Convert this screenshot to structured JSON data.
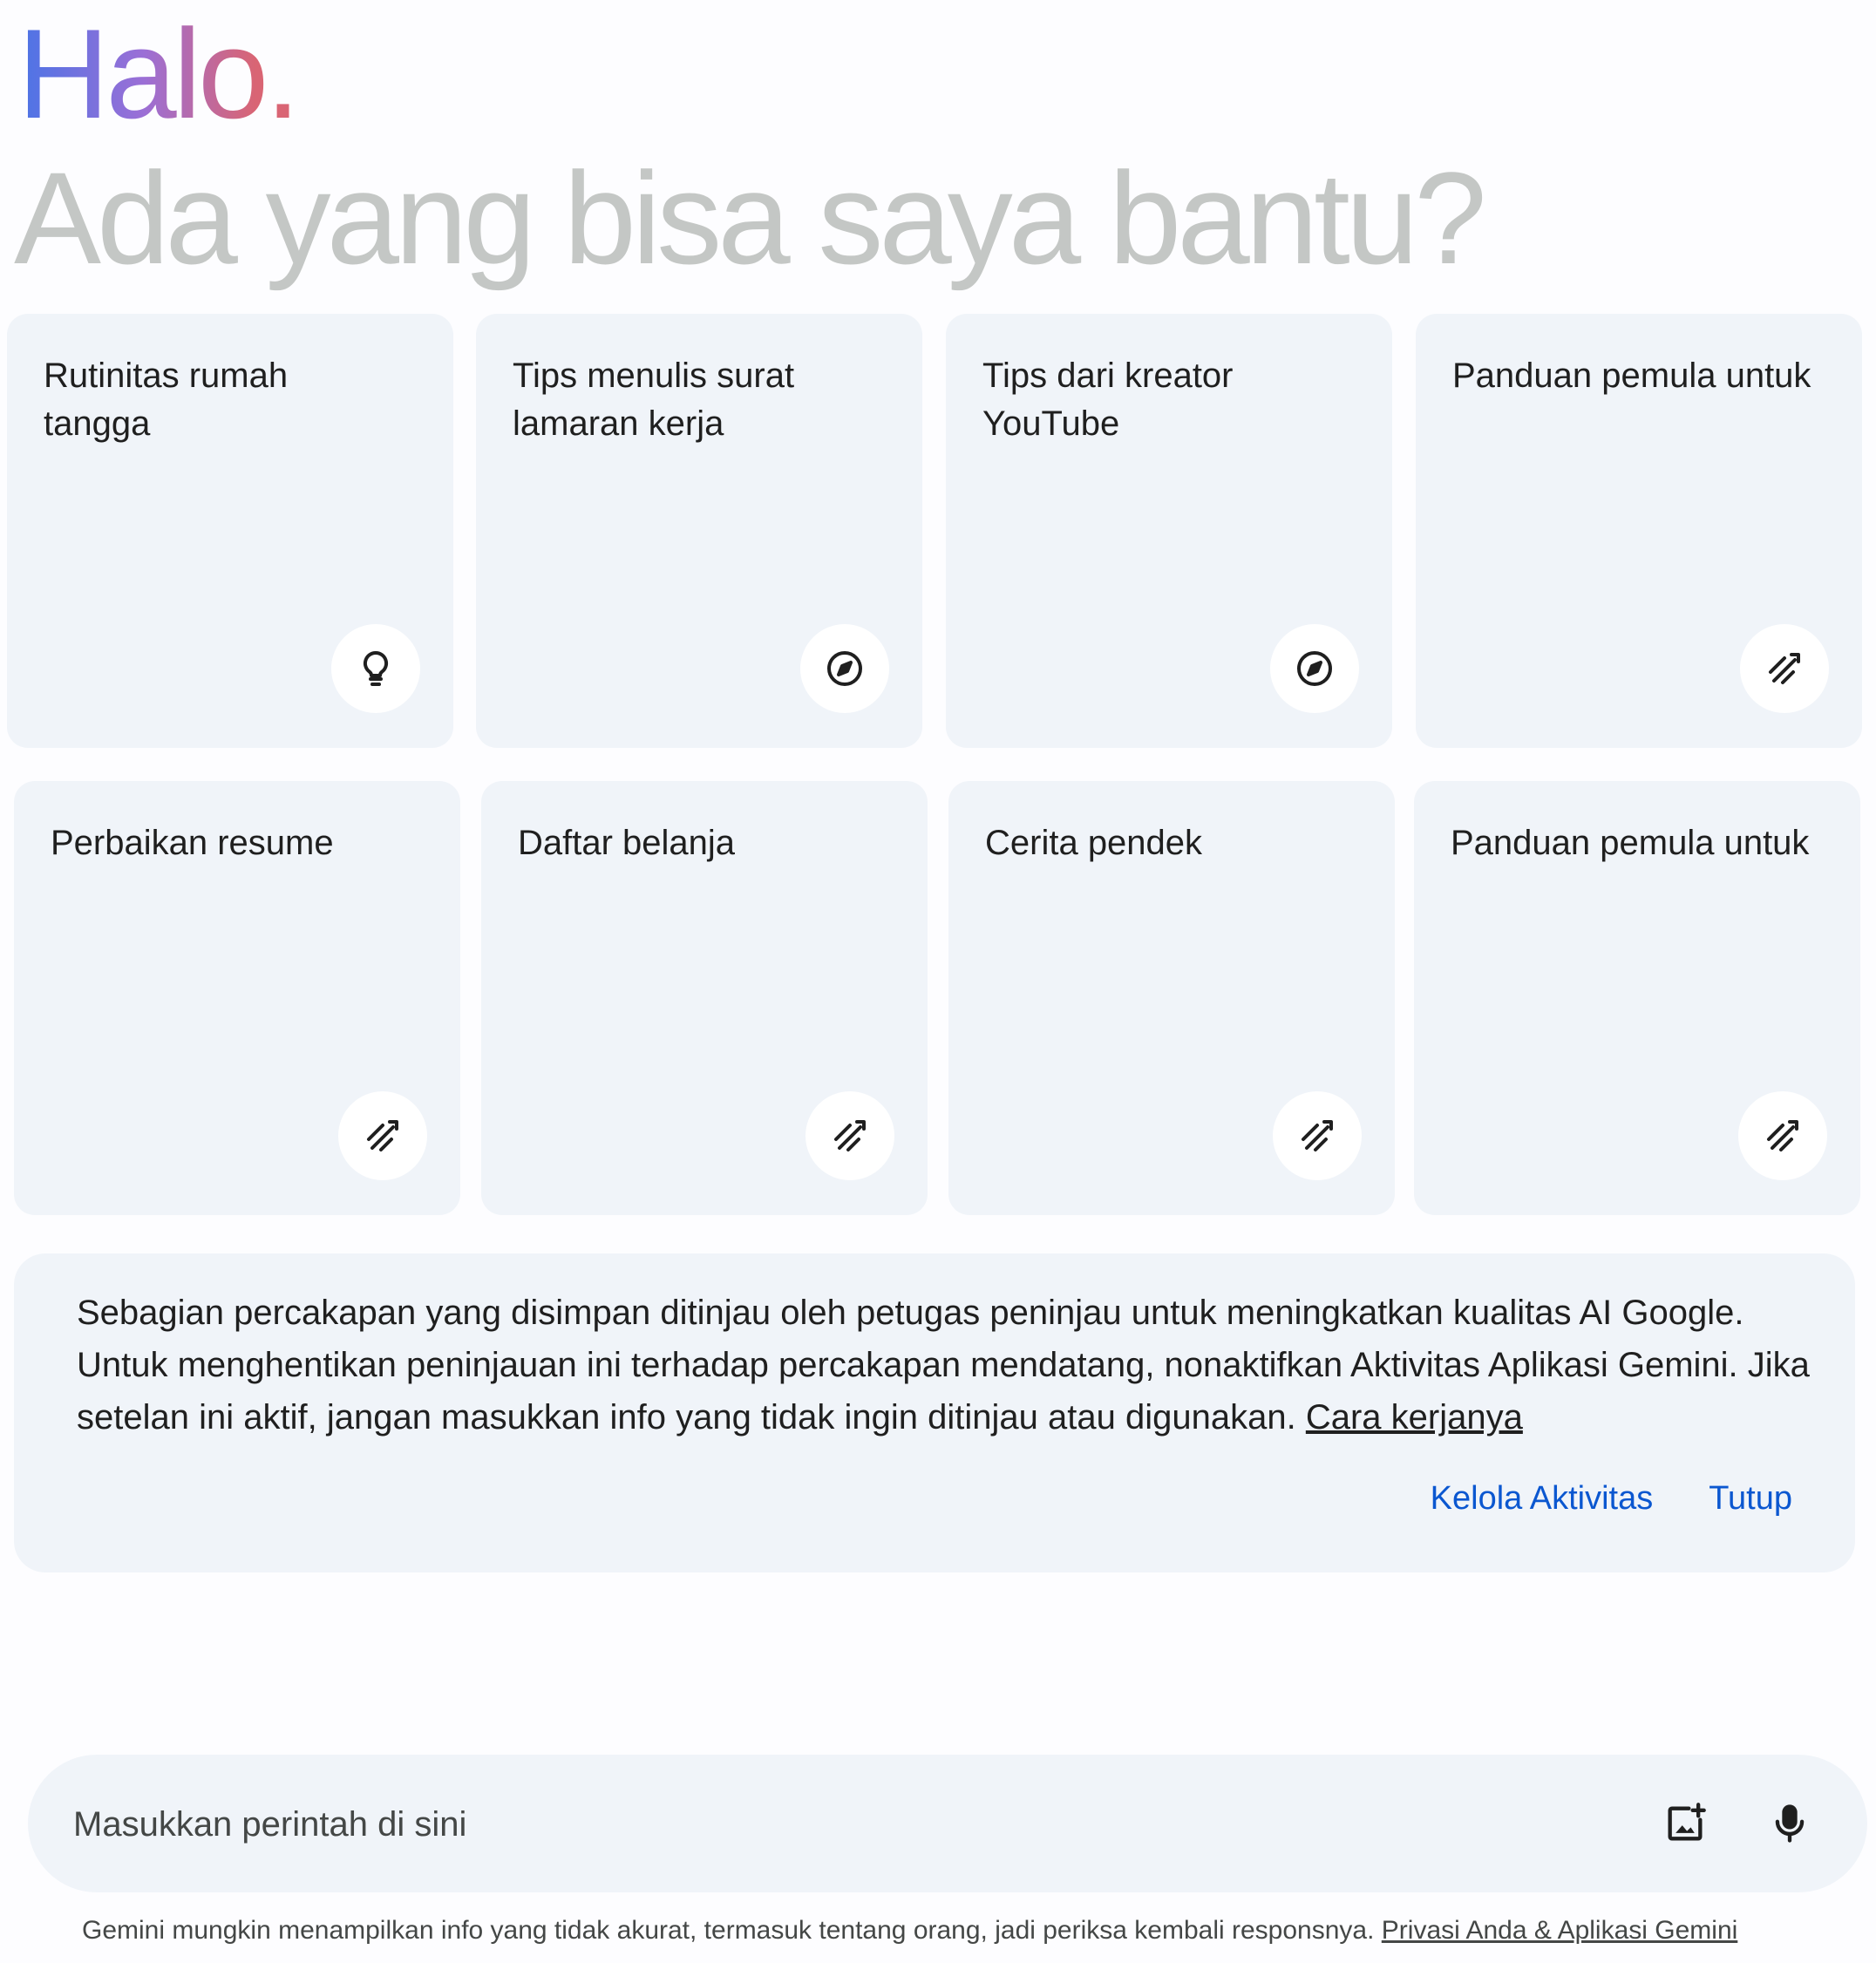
{
  "greeting": "Halo.",
  "subtitle": "Ada yang bisa saya bantu?",
  "cards": [
    {
      "label": "Rutinitas rumah\ntangga",
      "icon": "lightbulb-icon"
    },
    {
      "label": "Tips menulis surat\nlamaran kerja",
      "icon": "compass-icon"
    },
    {
      "label": "Tips dari kreator\nYouTube",
      "icon": "compass-icon"
    },
    {
      "label": "Panduan pemula untuk",
      "icon": "pen-spark-icon"
    },
    {
      "label": "Perbaikan resume",
      "icon": "pen-spark-icon"
    },
    {
      "label": "Daftar belanja",
      "icon": "pen-spark-icon"
    },
    {
      "label": "Cerita pendek",
      "icon": "pen-spark-icon"
    },
    {
      "label": "Panduan pemula untuk",
      "icon": "pen-spark-icon"
    }
  ],
  "notice": {
    "text": "Sebagian percakapan yang disimpan ditinjau oleh petugas peninjau untuk meningkatkan kualitas AI Google. Untuk menghentikan peninjauan ini terhadap percakapan mendatang, nonaktifkan Aktivitas Aplikasi Gemini. Jika setelan ini aktif, jangan masukkan info yang tidak ingin ditinjau atau digunakan.",
    "link": "Cara kerjanya",
    "manage_label": "Kelola Aktivitas",
    "close_label": "Tutup"
  },
  "prompt": {
    "placeholder": "Masukkan perintah di sini",
    "image_icon": "add-image-icon",
    "mic_icon": "microphone-icon"
  },
  "footer": {
    "text": "Gemini mungkin menampilkan info yang tidak akurat, termasuk tentang orang, jadi periksa kembali responsnya.",
    "link": "Privasi Anda & Aplikasi Gemini"
  },
  "colors": {
    "card_bg": "#f0f4f9",
    "accent_blue": "#0b57d0",
    "subtitle_gray": "#c4c7c5",
    "gradient": [
      "#4b74e6",
      "#9b6fd6",
      "#d96574"
    ]
  }
}
